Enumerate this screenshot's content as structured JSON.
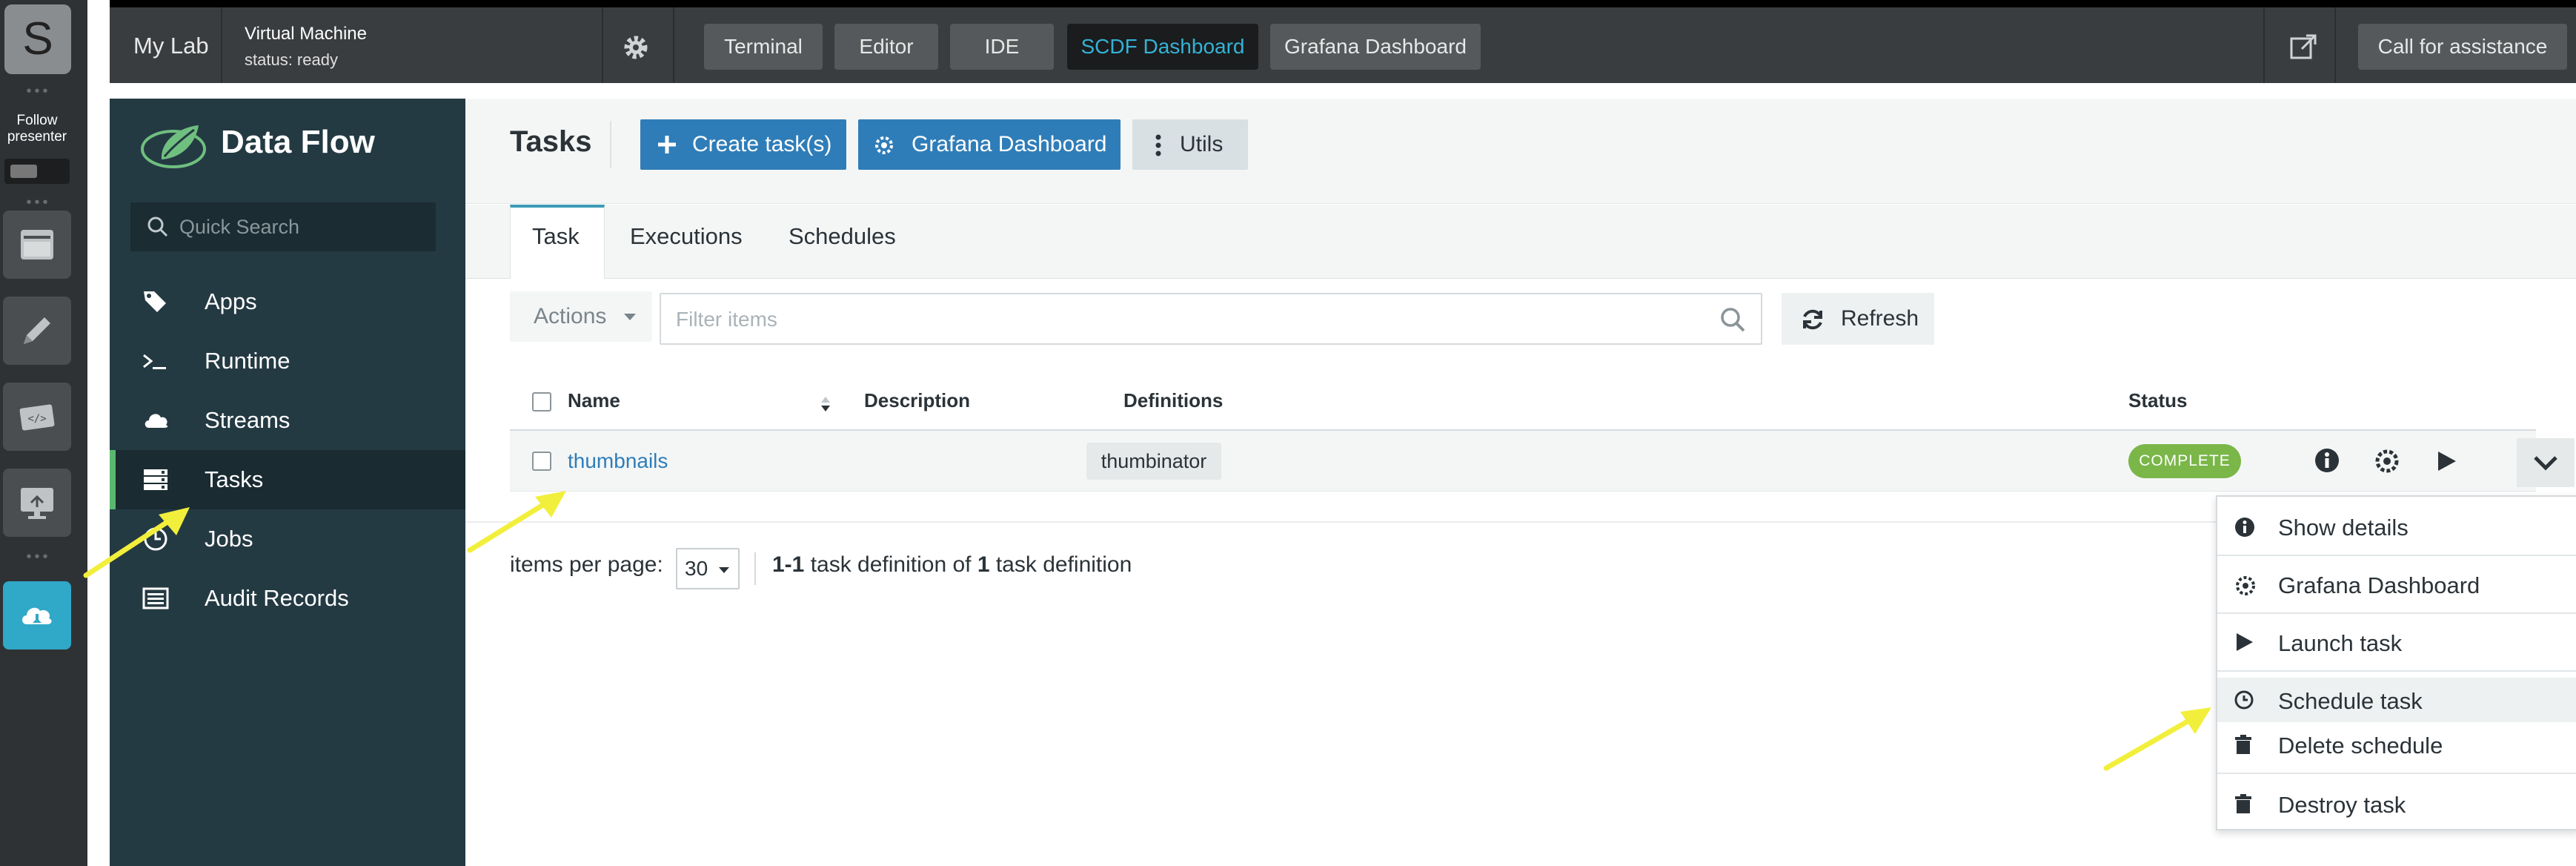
{
  "dock": {
    "logo_letter": "S",
    "follow_label": "Follow presenter"
  },
  "topbar": {
    "workspace": "My Lab",
    "vm_title": "Virtual Machine",
    "vm_status": "status: ready",
    "tabs": [
      "Terminal",
      "Editor",
      "IDE",
      "SCDF Dashboard",
      "Grafana Dashboard"
    ],
    "active_tab": "SCDF Dashboard",
    "assist_label": "Call for assistance"
  },
  "sidebar": {
    "brand": "Data Flow",
    "search_placeholder": "Quick Search",
    "items": [
      {
        "label": "Apps",
        "icon": "tags-icon"
      },
      {
        "label": "Runtime",
        "icon": "terminal-icon"
      },
      {
        "label": "Streams",
        "icon": "cloud-icon"
      },
      {
        "label": "Tasks",
        "icon": "server-icon"
      },
      {
        "label": "Jobs",
        "icon": "clock-icon"
      },
      {
        "label": "Audit Records",
        "icon": "list-icon"
      }
    ],
    "active_item": "Tasks"
  },
  "main": {
    "title": "Tasks",
    "buttons": {
      "create": "Create task(s)",
      "grafana": "Grafana Dashboard",
      "utils": "Utils"
    },
    "tabs": [
      "Task",
      "Executions",
      "Schedules"
    ],
    "active_tab": "Task",
    "toolbar": {
      "actions": "Actions",
      "filter_placeholder": "Filter items",
      "refresh": "Refresh"
    },
    "table": {
      "columns": [
        "Name",
        "Description",
        "Definitions",
        "Status"
      ],
      "rows": [
        {
          "name": "thumbnails",
          "description": "",
          "definition": "thumbinator",
          "status": "COMPLETE"
        }
      ]
    },
    "pager": {
      "label": "items per page:",
      "per_page": "30",
      "range": "1-1",
      "text_mid": " task definition of ",
      "total": "1",
      "text_end": " task definition"
    }
  },
  "menu": {
    "items": [
      "Show details",
      "Grafana Dashboard",
      "Launch task",
      "Schedule task",
      "Delete schedule",
      "Destroy task"
    ],
    "highlighted": "Schedule task"
  },
  "colors": {
    "accent_blue": "#2f7db8",
    "sidebar_bg": "#243a43",
    "status_green": "#7ab648",
    "annotation_yellow": "#f2ef3c",
    "scdf_tab_text": "#35b2d6"
  }
}
